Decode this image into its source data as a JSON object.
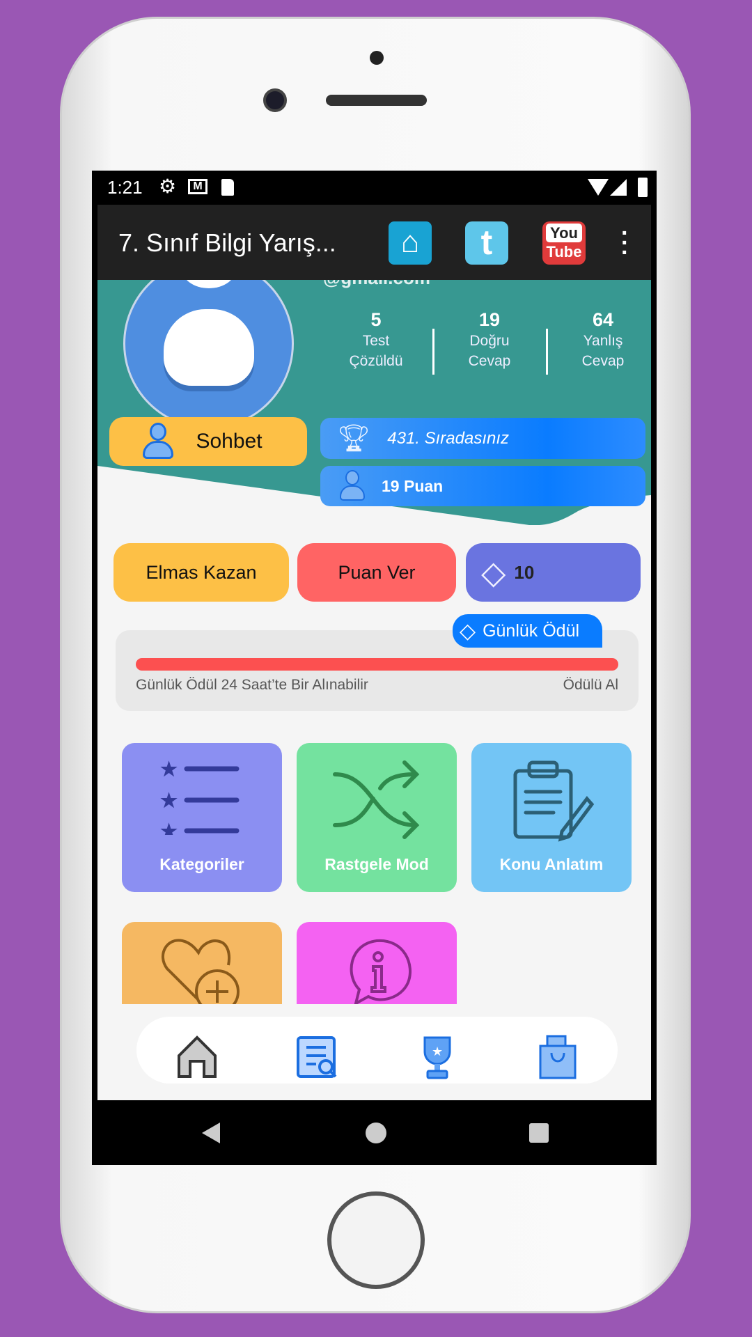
{
  "status_bar": {
    "time": "1:21",
    "icons": [
      "gear-icon",
      "gmail-icon",
      "sd-card-icon",
      "wifi-icon",
      "signal-icon",
      "battery-icon"
    ]
  },
  "app_bar": {
    "title": "7. Sınıf Bilgi Yarış...",
    "actions": [
      "home-icon",
      "twitter-icon",
      "youtube-icon",
      "more-vert-icon"
    ],
    "youtube_top": "You",
    "youtube_bottom": "Tube"
  },
  "profile": {
    "email": "@gmail.com",
    "stats": [
      {
        "value": "5",
        "label1": "Test",
        "label2": "Çözüldü"
      },
      {
        "value": "19",
        "label1": "Doğru",
        "label2": "Cevap"
      },
      {
        "value": "64",
        "label1": "Yanlış",
        "label2": "Cevap"
      }
    ],
    "chat_label": "Sohbet",
    "rank_label": "431. Sıradasınız",
    "points_label": "19 Puan"
  },
  "actions": {
    "earn_diamonds": "Elmas Kazan",
    "rate": "Puan Ver",
    "diamonds": "10"
  },
  "daily_reward": {
    "badge": "Günlük Ödül",
    "info": "Günlük Ödül 24 Saat’te Bir Alınabilir",
    "claim": "Ödülü Al",
    "progress": 1.0
  },
  "tiles": [
    {
      "label": "Kategoriler",
      "color": "#8b8ff2"
    },
    {
      "label": "Rastgele Mod",
      "color": "#74e29f"
    },
    {
      "label": "Konu Anlatım",
      "color": "#73c5f5"
    },
    {
      "label": "",
      "color": "#f5b862"
    },
    {
      "label": "",
      "color": "#f462f2"
    }
  ],
  "bottom_nav": [
    "home-icon",
    "quiz-list-icon",
    "trophy-icon",
    "shopping-bag-icon"
  ],
  "colors": {
    "background": "#9a57b4",
    "teal": "#379891",
    "accent_blue": "#0a7cff",
    "yellow": "#fdc046",
    "red": "#ff6464",
    "diamond_purple": "#6a74e0"
  }
}
